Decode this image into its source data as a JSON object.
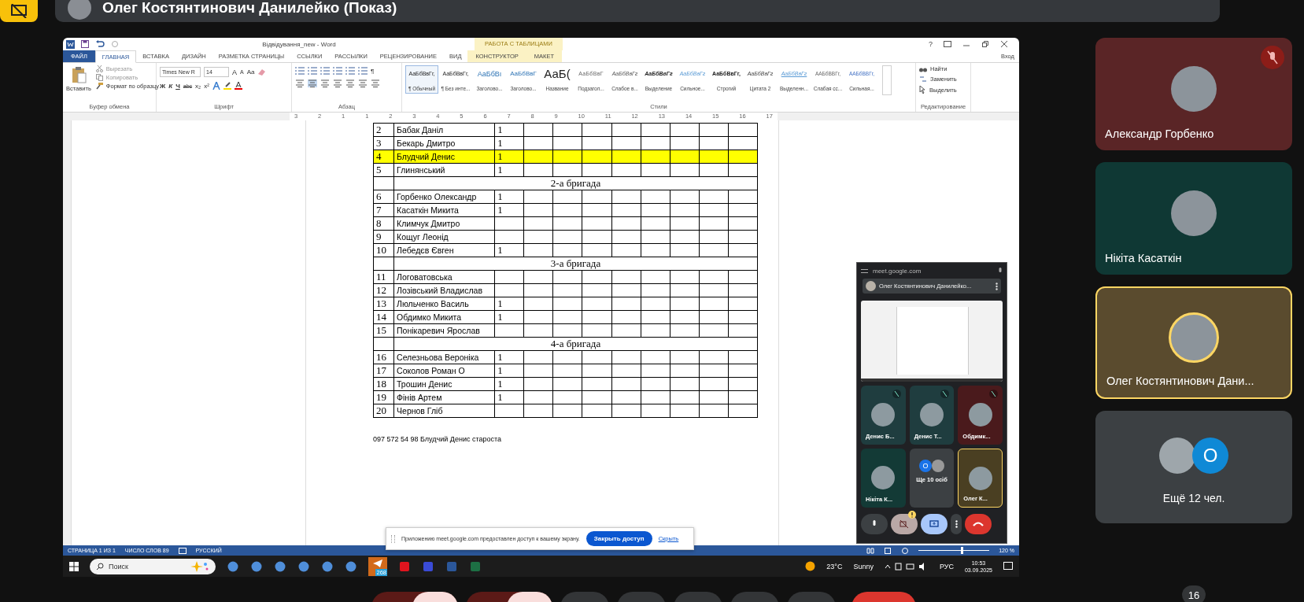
{
  "meeting_header": {
    "presenter": "Олег Костянтинович Данилейко (Показ)"
  },
  "word": {
    "title": "Відвідування_new - Word",
    "context_group": "РАБОТА С ТАБЛИЦАМИ",
    "help": "?",
    "sign_in": "Вход",
    "tabs": [
      {
        "label": "ФАЙЛ",
        "kind": "file",
        "selected": false
      },
      {
        "label": "ГЛАВНАЯ",
        "kind": "normal",
        "selected": true
      },
      {
        "label": "ВСТАВКА",
        "kind": "normal",
        "selected": false
      },
      {
        "label": "ДИЗАЙН",
        "kind": "normal",
        "selected": false
      },
      {
        "label": "РАЗМЕТКА СТРАНИЦЫ",
        "kind": "normal",
        "selected": false
      },
      {
        "label": "ССЫЛКИ",
        "kind": "normal",
        "selected": false
      },
      {
        "label": "РАССЫЛКИ",
        "kind": "normal",
        "selected": false
      },
      {
        "label": "РЕЦЕНЗИРОВАНИЕ",
        "kind": "normal",
        "selected": false
      },
      {
        "label": "ВИД",
        "kind": "normal",
        "selected": false
      },
      {
        "label": "КОНСТРУКТОР",
        "kind": "context",
        "selected": false
      },
      {
        "label": "МАКЕТ",
        "kind": "context",
        "selected": false
      }
    ],
    "clipboard": {
      "paste": "Вставить",
      "cut": "Вырезать",
      "copy": "Копировать",
      "format_painter": "Формат по образцу",
      "group_label": "Буфер обмена"
    },
    "font": {
      "name": "Times New R",
      "size": "14",
      "grow": "A",
      "shrink": "A",
      "case": "Aa",
      "bold": "Ж",
      "italic": "К",
      "underline": "Ч",
      "strike": "abc",
      "subscript": "x₂",
      "superscript": "x²",
      "group_label": "Шрифт"
    },
    "paragraph": {
      "pilcrow": "¶",
      "group_label": "Абзац"
    },
    "styles": {
      "group_label": "Стили",
      "items": [
        {
          "sample": "АаБбВвГг,",
          "name": "¶ Обычный",
          "kind": "normal",
          "selected": true
        },
        {
          "sample": "АаБбВвГг,",
          "name": "¶ Без инте...",
          "kind": "normal",
          "selected": false
        },
        {
          "sample": "АаБбВı",
          "name": "Заголово...",
          "kind": "heading1",
          "selected": false
        },
        {
          "sample": "АаБбВвГ",
          "name": "Заголово...",
          "kind": "heading2",
          "selected": false
        },
        {
          "sample": "АаБ(",
          "name": "Название",
          "kind": "title",
          "selected": false
        },
        {
          "sample": "АаБбВвГ",
          "name": "Подзагол...",
          "kind": "subtitle",
          "selected": false
        },
        {
          "sample": "АаБбВвГг",
          "name": "Слабое в...",
          "kind": "subtle",
          "selected": false
        },
        {
          "sample": "АаБбВвГг",
          "name": "Выделение",
          "kind": "emphasis",
          "selected": false
        },
        {
          "sample": "АаБбВвГг",
          "name": "Сильное...",
          "kind": "intense",
          "selected": false
        },
        {
          "sample": "АаБбВвГг,",
          "name": "Строгий",
          "kind": "strong",
          "selected": false
        },
        {
          "sample": "АаБбВвГг",
          "name": "Цитата 2",
          "kind": "quote",
          "selected": false
        },
        {
          "sample": "АаБбВвГг",
          "name": "Выделенн...",
          "kind": "intense-quote",
          "selected": false
        },
        {
          "sample": "ААБбВВГг,",
          "name": "Слабая сс...",
          "kind": "subtle-ref",
          "selected": false
        },
        {
          "sample": "ААБбВВГг,",
          "name": "Сильная...",
          "kind": "intense-ref",
          "selected": false
        }
      ]
    },
    "editing": {
      "find": "Найти",
      "replace": "Заменить",
      "select": "Выделить",
      "group_label": "Редактирование"
    },
    "ruler": [
      "3",
      "2",
      "1",
      "1",
      "2",
      "3",
      "4",
      "5",
      "6",
      "7",
      "8",
      "9",
      "10",
      "11",
      "12",
      "13",
      "14",
      "15",
      "16",
      "17"
    ],
    "table": {
      "rows": [
        {
          "kind": "person",
          "number": "2",
          "name": "Бабак Даніл",
          "mark": "1",
          "highlighted": false
        },
        {
          "kind": "person",
          "number": "3",
          "name": "Бекарь Дмитро",
          "mark": "1",
          "highlighted": false
        },
        {
          "kind": "person",
          "number": "4",
          "name": "Блудчий Денис",
          "mark": "1",
          "highlighted": true
        },
        {
          "kind": "person",
          "number": "5",
          "name": "Глинянський",
          "mark": "1",
          "highlighted": false
        },
        {
          "kind": "group",
          "title": "2-а бригада"
        },
        {
          "kind": "person",
          "number": "6",
          "name": "Горбенко Олександр",
          "mark": "1",
          "highlighted": false
        },
        {
          "kind": "person",
          "number": "7",
          "name": "Касаткін Микита",
          "mark": "1",
          "highlighted": false
        },
        {
          "kind": "person",
          "number": "8",
          "name": "Климчук Дмитро",
          "highlighted": false
        },
        {
          "kind": "person",
          "number": "9",
          "name": "Кощуг Леонід",
          "highlighted": false
        },
        {
          "kind": "person",
          "number": "10",
          "name": "Лебедєв Євген",
          "mark": "1",
          "highlighted": false
        },
        {
          "kind": "group",
          "title": "3-а бригада"
        },
        {
          "kind": "person",
          "number": "11",
          "name": "Логоватовська",
          "highlighted": false
        },
        {
          "kind": "person",
          "number": "12",
          "name": "Лозівський Владислав",
          "highlighted": false
        },
        {
          "kind": "person",
          "number": "13",
          "name": "Люльченко Василь",
          "mark": "1",
          "highlighted": false
        },
        {
          "kind": "person",
          "number": "14",
          "name": "Обдимко Микита",
          "mark": "1",
          "highlighted": false
        },
        {
          "kind": "person",
          "number": "15",
          "name": "Понікаревич Ярослав",
          "highlighted": false
        },
        {
          "kind": "group",
          "title": "4-а бригада"
        },
        {
          "kind": "person",
          "number": "16",
          "name": "Селезньова Вероніка",
          "mark": "1",
          "highlighted": false
        },
        {
          "kind": "person",
          "number": "17",
          "name": "Соколов Роман О",
          "mark": "1",
          "highlighted": false
        },
        {
          "kind": "person",
          "number": "18",
          "name": "Трошин Денис",
          "mark": "1",
          "highlighted": false
        },
        {
          "kind": "person",
          "number": "19",
          "name": "Фінів Артем",
          "mark": "1",
          "highlighted": false
        },
        {
          "kind": "person",
          "number": "20",
          "name": "Чернов Гліб",
          "highlighted": false
        }
      ]
    },
    "footer_line": "097 572 54 98 Блудчий Денис староста",
    "status_bar": {
      "page": "СТРАНИЦА 1 ИЗ 1",
      "words": "ЧИСЛО СЛОВ 89",
      "language": "РУССКИЙ",
      "zoom": "120 %",
      "zoom_slider": {
        "level": 0.6
      }
    }
  },
  "share_notice": {
    "text": "Приложению meet.google.com предоставлен доступ к вашему экрану.",
    "button": "Закрыть доступ",
    "link": "Скрыть"
  },
  "taskbar": {
    "search_placeholder": "Поиск",
    "telegram_badge": "268",
    "temperature": "23°C",
    "weather": "Sunny",
    "language": "РУС",
    "time": "10:53",
    "date": "03.09.2025"
  },
  "meet_popup": {
    "url": "meet.google.com",
    "presenter": "Олег Костянтинович Данилейко...",
    "tiles": [
      {
        "kind": "person",
        "name": "Денис Б...",
        "color": "#1f3d3f",
        "muted": true,
        "active": false
      },
      {
        "kind": "person",
        "name": "Денис Т...",
        "color": "#1f3d3f",
        "muted": true,
        "active": false
      },
      {
        "kind": "person",
        "name": "Обдимк...",
        "color": "#4a1a1c",
        "muted": true,
        "active": false
      },
      {
        "kind": "person",
        "name": "Нікіта К...",
        "color": "#133a36",
        "muted": false,
        "active": false
      },
      {
        "kind": "others",
        "name": "Ще 10 осіб",
        "initial": "О",
        "color": "#3c4043",
        "muted": false,
        "active": false
      },
      {
        "kind": "person",
        "name": "Олег К...",
        "color": "#4a3f22",
        "muted": false,
        "active": true
      }
    ]
  },
  "participants": [
    {
      "kind": "person",
      "name": "Александр Горбенко",
      "color": "#5a2526",
      "muted": true,
      "active": false
    },
    {
      "kind": "person",
      "name": "Нікіта Касаткін",
      "color": "#0f3834",
      "muted": false,
      "active": false
    },
    {
      "kind": "person",
      "name": "Олег Костянтинович Дани...",
      "color": "#5a4b2e",
      "muted": false,
      "active": true
    },
    {
      "kind": "others",
      "name": "Ещё 12 чел.",
      "initial": "О",
      "color": "#3c4043",
      "muted": false,
      "active": false
    }
  ],
  "participant_count": "16"
}
